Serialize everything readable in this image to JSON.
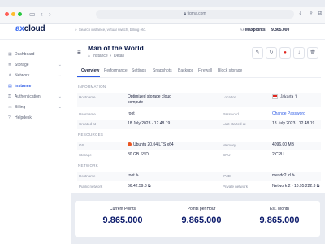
{
  "browser": {
    "url": "figma.com"
  },
  "header": {
    "logo": {
      "prefix": "",
      "x": "x",
      "cloud": "cloud",
      "lead": "a"
    },
    "search_placeholder": "Search instance, virtual switch, billing etc.",
    "points_label": "Maxpoints",
    "points_value": "9.865.000"
  },
  "sidebar": {
    "items": [
      {
        "label": "Dashboard",
        "icon": "grid-icon"
      },
      {
        "label": "Storage",
        "icon": "database-icon",
        "expandable": true
      },
      {
        "label": "Network",
        "icon": "network-icon",
        "expandable": true
      },
      {
        "label": "Instance",
        "icon": "server-icon",
        "active": true
      },
      {
        "label": "Authentication",
        "icon": "lock-icon",
        "expandable": true
      },
      {
        "label": "Billing",
        "icon": "card-icon",
        "expandable": true
      },
      {
        "label": "Helpdesk",
        "icon": "help-icon"
      }
    ]
  },
  "page": {
    "title": "Man of the World",
    "breadcrumb": [
      "Instance",
      "Detail"
    ],
    "tabs": [
      "Overview",
      "Performance",
      "Settings",
      "Snapshots",
      "Backups",
      "Firewall",
      "Block storage"
    ],
    "active_tab": "Overview"
  },
  "information": {
    "section_title": "INFORMATION",
    "hostname_label": "Hostname",
    "hostname_value_line1": "Optimized storage cloud",
    "hostname_value_line2": "compute",
    "location_label": "Location",
    "location_value": "Jakarta 1",
    "username_label": "Username",
    "username_value": "root",
    "password_label": "Password",
    "password_value": "Change Password",
    "created_label": "Created at",
    "created_value": "18 July 2023  ·  12.48.19",
    "last_started_label": "Last started at",
    "last_started_value": "18 July 2023  ·  12.48.19"
  },
  "resources": {
    "section_title": "RESOURCES",
    "os_label": "OS",
    "os_value": "Ubuntu 20.04 LTS x64",
    "memory_label": "Memory",
    "memory_value": "4096.00 MB",
    "storage_label": "Storage",
    "storage_value": "80 GB SSD",
    "cpu_label": "CPU",
    "cpu_value": "2 CPU"
  },
  "network": {
    "section_title": "NETWORK",
    "hostname_label": "Hostname",
    "hostname_value": "root",
    "ip_label": "IP/ID",
    "ip_value": "mesdc2.id",
    "public_label": "Public network",
    "public_value": "66.42.59.8",
    "private_label": "Private network",
    "private_value": "Network 2 - 10.95.222.3"
  },
  "stats": [
    {
      "label": "Current Points",
      "value": "9.865.000"
    },
    {
      "label": "Points per Hour",
      "value": "9.865.000"
    },
    {
      "label": "Est. Month",
      "value": "9.865.000"
    }
  ],
  "colors": {
    "accent": "#2b59e6",
    "brand": "#0b1a4a",
    "stat_value": "#0b1a6b"
  }
}
